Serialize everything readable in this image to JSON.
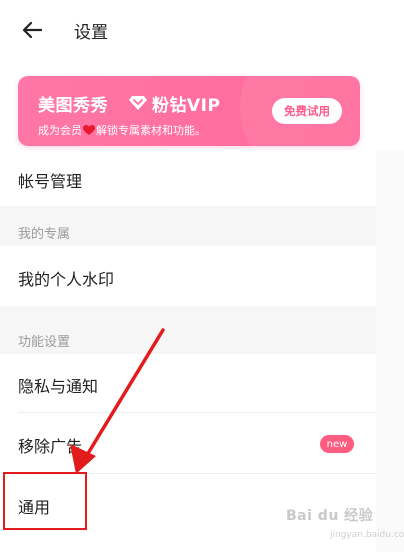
{
  "header": {
    "title": "设置",
    "back_icon": "arrow-left-icon"
  },
  "vip": {
    "brand": "美图秀秀",
    "tier": "粉钻VIP",
    "desc_before": "成为会员",
    "desc_after": "解锁专属素材和功能。",
    "cta": "免费试用",
    "colors": {
      "banner": "#ff6f9f",
      "cta_text": "#ff5b8c"
    }
  },
  "rows": {
    "account": "帐号管理",
    "my_watermark": "我的个人水印",
    "privacy": "隐私与通知",
    "remove_ads": "移除广告",
    "general": "通用"
  },
  "sections": {
    "mine": "我的专属",
    "features": "功能设置"
  },
  "badge": {
    "new": "new",
    "color": "#ff5c7f"
  },
  "watermark": {
    "main": "Bai du 经验",
    "sub": "jingyan.baidu.com"
  },
  "annotation": {
    "color": "#e21c1c"
  }
}
